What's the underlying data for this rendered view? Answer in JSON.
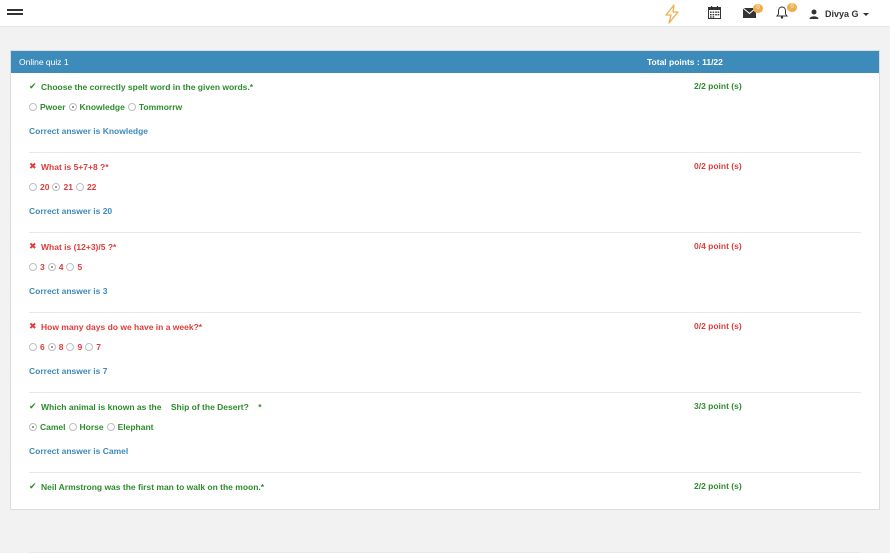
{
  "topbar": {
    "user_name": "Divya G",
    "message_count": "0",
    "notification_count": "0",
    "accent": "#f0ad4e"
  },
  "quiz": {
    "title": "Online quiz 1",
    "total_points": "Total points : 11/22",
    "header_color": "#3d8bba",
    "questions": [
      {
        "text": "Choose the correctly spelt word in the given words.*",
        "status": "correct",
        "points": "2/2 point (s)",
        "options": [
          "Pwoer",
          "Knowledge",
          "Tommorrw"
        ],
        "selected": "Knowledge",
        "answer": "Correct answer is Knowledge"
      },
      {
        "text": "What is 5+7+8 ?*",
        "status": "wrong",
        "points": "0/2 point (s)",
        "options": [
          "20",
          "21",
          "22"
        ],
        "selected": "21",
        "answer": "Correct answer is 20"
      },
      {
        "text": "What is (12+3)/5 ?*",
        "status": "wrong",
        "points": "0/4 point (s)",
        "options": [
          "3",
          "4",
          "5"
        ],
        "selected": "4",
        "answer": "Correct answer is 3"
      },
      {
        "text": "How many days do we have in a week?*",
        "status": "wrong",
        "points": "0/2 point (s)",
        "options": [
          "6",
          "8",
          "9",
          "7"
        ],
        "selected": "8",
        "answer": "Correct answer is 7"
      },
      {
        "text": "Which animal is known as the    Ship of the Desert?    *",
        "status": "correct",
        "points": "3/3 point (s)",
        "options": [
          "Camel",
          "Horse",
          "Elephant"
        ],
        "selected": "Camel",
        "answer": "Correct answer is Camel"
      },
      {
        "text": "Neil Armstrong was the first man to walk on the moon.*",
        "status": "correct",
        "points": "2/2 point (s)",
        "options": [],
        "selected": "",
        "answer": ""
      }
    ]
  }
}
